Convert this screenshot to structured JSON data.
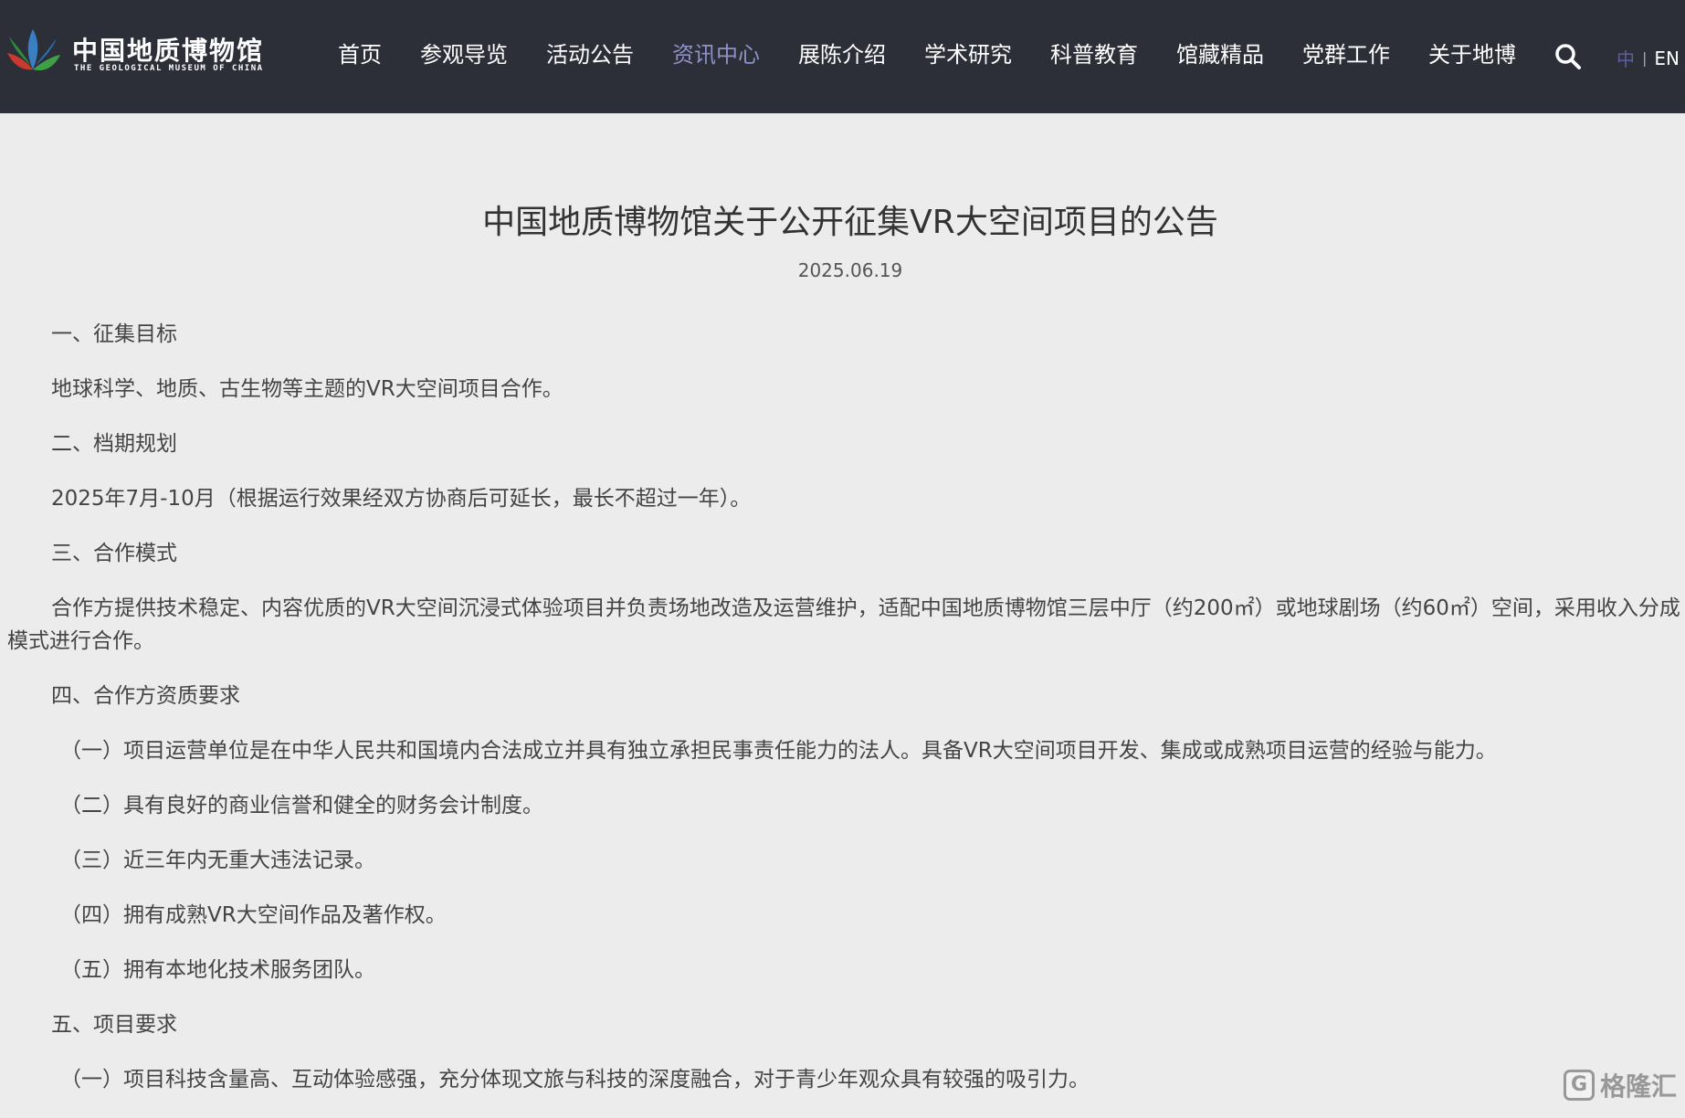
{
  "header": {
    "logo": {
      "name_cn": "中国地质博物馆",
      "name_en": "THE GEOLOGICAL MUSEUM OF CHINA"
    },
    "nav": [
      {
        "label": "首页",
        "active": false
      },
      {
        "label": "参观导览",
        "active": false
      },
      {
        "label": "活动公告",
        "active": false
      },
      {
        "label": "资讯中心",
        "active": true
      },
      {
        "label": "展陈介绍",
        "active": false
      },
      {
        "label": "学术研究",
        "active": false
      },
      {
        "label": "科普教育",
        "active": false
      },
      {
        "label": "馆藏精品",
        "active": false
      },
      {
        "label": "党群工作",
        "active": false
      },
      {
        "label": "关于地博",
        "active": false
      }
    ],
    "search_icon": "search-icon",
    "lang": {
      "cn": "中",
      "sep": "|",
      "en": "EN"
    }
  },
  "article": {
    "title": "中国地质博物馆关于公开征集VR大空间项目的公告",
    "date": "2025.06.19",
    "paragraphs": [
      "一、征集目标",
      "地球科学、地质、古生物等主题的VR大空间项目合作。",
      "二、档期规划",
      "2025年7月-10月（根据运行效果经双方协商后可延长，最长不超过一年）。",
      "三、合作模式",
      "合作方提供技术稳定、内容优质的VR大空间沉浸式体验项目并负责场地改造及运营维护，适配中国地质博物馆三层中厅（约200㎡）或地球剧场（约60㎡）空间，采用收入分成模式进行合作。",
      "四、合作方资质要求",
      "（一）项目运营单位是在中华人民共和国境内合法成立并具有独立承担民事责任能力的法人。具备VR大空间项目开发、集成或成熟项目运营的经验与能力。",
      "（二）具有良好的商业信誉和健全的财务会计制度。",
      "（三）近三年内无重大违法记录。",
      "（四）拥有成熟VR大空间作品及著作权。",
      "（五）拥有本地化技术服务团队。",
      "五、项目要求",
      "（一）项目科技含量高、互动体验感强，充分体现文旅与科技的深度融合，对于青少年观众具有较强的吸引力。"
    ]
  },
  "watermark": {
    "icon": "G",
    "text": "格隆汇"
  },
  "colors": {
    "header_bg": "#2d2f38",
    "nav_active": "#8f92c8",
    "page_bg": "#ececec"
  }
}
